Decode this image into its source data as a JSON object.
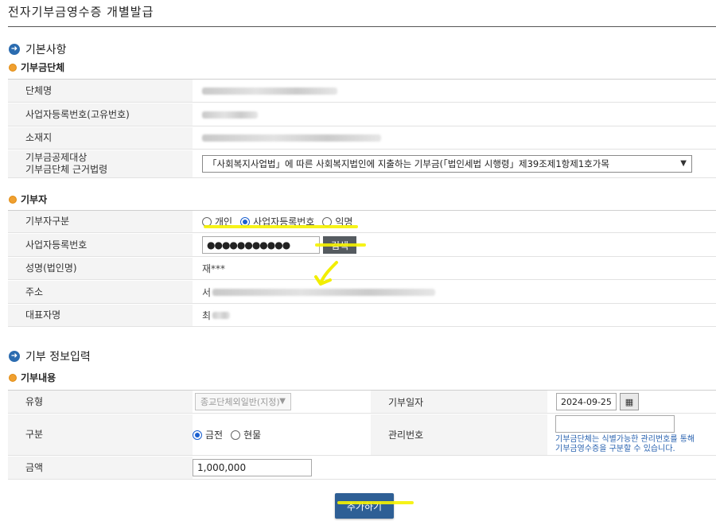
{
  "page": {
    "title": "전자기부금영수증 개별발급"
  },
  "basic": {
    "section_title": "기본사항",
    "org_title": "기부금단체",
    "org_name_label": "단체명",
    "org_bizno_label": "사업자등록번호(고유번호)",
    "org_address_label": "소재지",
    "law_label_line1": "기부금공제대상",
    "law_label_line2": "기부금단체 근거법령",
    "law_selected": "「사회복지사업법」에 따른 사회복지법인에 지출하는 기부금(「법인세법 시행령」제39조제1항제1호가목"
  },
  "donor": {
    "title": "기부자",
    "type_label": "기부자구분",
    "type_options": [
      "개인",
      "사업자등록번호",
      "익명"
    ],
    "type_selected": "사업자등록번호",
    "bizno_label": "사업자등록번호",
    "bizno_value": "●●●●●●●●●●●",
    "search_button": "검색",
    "name_label": "성명(법인명)",
    "name_value": "재***",
    "address_label": "주소",
    "address_prefix": "서",
    "rep_label": "대표자명",
    "rep_prefix": "최"
  },
  "donation": {
    "section_title": "기부 정보입력",
    "content_title": "기부내용",
    "kind_label": "유형",
    "kind_value": "종교단체외일반(지정)",
    "date_label": "기부일자",
    "date_value": "2024-09-25",
    "category_label": "구분",
    "category_options": [
      "금전",
      "현물"
    ],
    "category_selected": "금전",
    "manage_no_label": "관리번호",
    "manage_no_value": "",
    "manage_note_line1": "기부금단체는 식별가능한 관리번호를 통해",
    "manage_note_line2": "기부금영수증을 구분할 수 있습니다.",
    "amount_label": "금액",
    "amount_value": "1,000,000"
  },
  "actions": {
    "add_button": "추가하기"
  },
  "icons": {
    "section": "arrow-right-circle-icon",
    "subsection": "orange-dot-icon",
    "calendar": "calendar-icon",
    "dropdown": "chevron-down-icon"
  },
  "colors": {
    "accent_blue": "#2b6cb0",
    "button_blue": "#2e5f95",
    "highlight": "#f5f200",
    "search_button": "#555b60"
  }
}
